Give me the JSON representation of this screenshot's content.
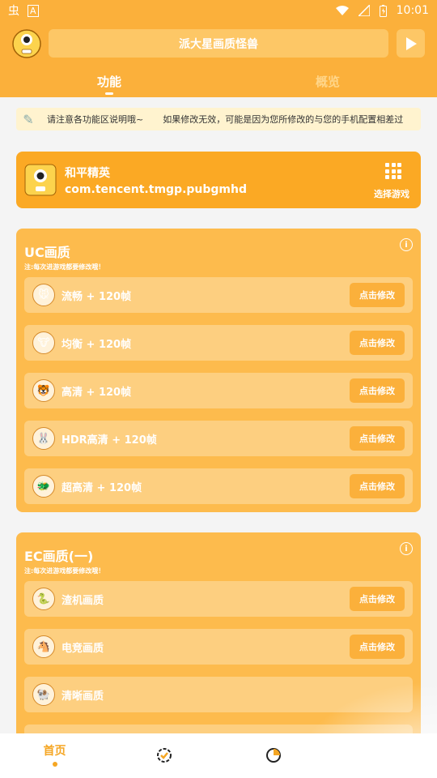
{
  "status_bar": {
    "time": "10:01",
    "app_glyph": "虫",
    "a_glyph": "A"
  },
  "header": {
    "title": "派大星画质怪兽",
    "tabs": [
      {
        "label": "功能"
      },
      {
        "label": "概览"
      }
    ]
  },
  "notice": {
    "text1": "请注意各功能区说明哦~",
    "text2": "如果修改无效，可能是因为您所修改的与您的手机配置相差过"
  },
  "game": {
    "name": "和平精英",
    "package": "com.tencent.tmgp.pubgmhd",
    "select_label": "选择游戏"
  },
  "uc_section": {
    "title": "UC画质",
    "note": "注:每次进游戏都要修改哦！",
    "items": [
      {
        "label": "流畅 + 120帧",
        "button": "点击修改",
        "icon": "mouse-icon"
      },
      {
        "label": "均衡 + 120帧",
        "button": "点击修改",
        "icon": "cow-icon"
      },
      {
        "label": "高清 + 120帧",
        "button": "点击修改",
        "icon": "tiger-icon"
      },
      {
        "label": "HDR高清 + 120帧",
        "button": "点击修改",
        "icon": "rabbit-icon"
      },
      {
        "label": "超高清 + 120帧",
        "button": "点击修改",
        "icon": "dragon-icon"
      }
    ]
  },
  "ec_section": {
    "title": "EC画质(一)",
    "note": "注:每次进游戏都要修改哦！",
    "items": [
      {
        "label": "渣机画质",
        "button": "点击修改",
        "icon": "snake-icon"
      },
      {
        "label": "电竞画质",
        "button": "点击修改",
        "icon": "horse-icon"
      },
      {
        "label": "清晰画质",
        "button": "",
        "icon": "goat-icon"
      }
    ]
  },
  "bottom_nav": {
    "home_label": "首页"
  },
  "colors": {
    "primary": "#fbb03b",
    "card": "#fba924",
    "section": "#fdbb4d",
    "item": "#fdcf80",
    "notice_bg": "#fff3cf"
  }
}
